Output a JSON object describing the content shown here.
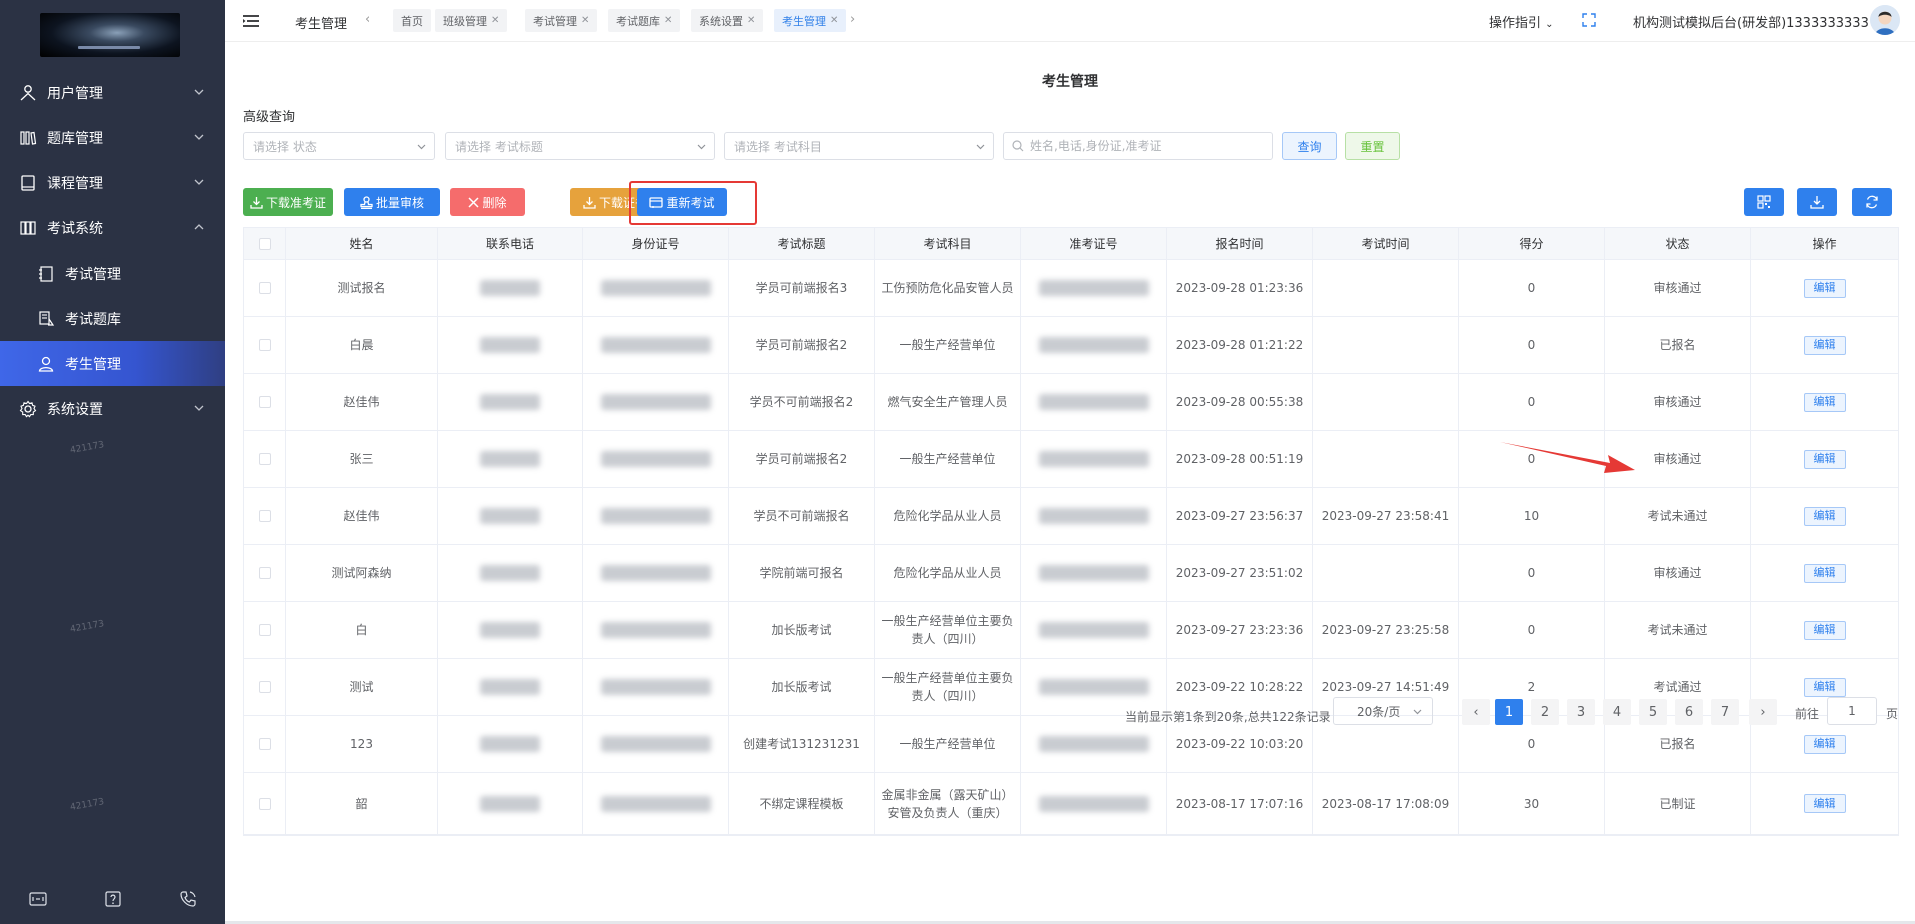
{
  "header": {
    "title": "考生管理",
    "tabs": [
      {
        "label": "首页",
        "closable": false
      },
      {
        "label": "班级管理",
        "closable": true
      },
      {
        "label": "考试管理",
        "closable": true
      },
      {
        "label": "考试题库",
        "closable": true
      },
      {
        "label": "系统设置",
        "closable": true
      },
      {
        "label": "考生管理",
        "closable": true,
        "active": true
      }
    ],
    "guide_label": "操作指引",
    "user_label": "机构测试模拟后台(研发部)1333333333"
  },
  "sidebar": {
    "menus": [
      {
        "label": "用户管理",
        "icon": "user-group-icon",
        "expanded": false
      },
      {
        "label": "题库管理",
        "icon": "books-icon",
        "expanded": false
      },
      {
        "label": "课程管理",
        "icon": "book-icon",
        "expanded": false
      },
      {
        "label": "考试系统",
        "icon": "exam-system-icon",
        "expanded": true,
        "children": [
          {
            "label": "考试管理",
            "icon": "exam-manage-icon"
          },
          {
            "label": "考试题库",
            "icon": "exam-bank-icon"
          },
          {
            "label": "考生管理",
            "icon": "person-icon",
            "active": true
          }
        ]
      },
      {
        "label": "系统设置",
        "icon": "gear-icon",
        "expanded": false
      }
    ],
    "watermark": "421173"
  },
  "main": {
    "title": "考生管理",
    "advanced_label": "高级查询",
    "filters": {
      "status_placeholder": "请选择 状态",
      "exam_title_placeholder": "请选择 考试标题",
      "subject_placeholder": "请选择 考试科目",
      "search_placeholder": "姓名,电话,身份证,准考证",
      "query_label": "查询",
      "reset_label": "重置"
    },
    "toolbar": {
      "download_ticket": "下载准考证",
      "batch_review": "批量审核",
      "delete": "删除",
      "download_cert": "下载证书",
      "reexam": "重新考试"
    },
    "columns": [
      "姓名",
      "联系电话",
      "身份证号",
      "考试标题",
      "考试科目",
      "准考证号",
      "报名时间",
      "考试时间",
      "得分",
      "状态",
      "操作"
    ],
    "rows": [
      {
        "name": "测试报名",
        "title": "学员可前端报名3",
        "subject": "工伤预防危化品安管人员",
        "reg_time": "2023-09-28 01:23:36",
        "exam_time": "",
        "score": "0",
        "status": "审核通过",
        "action": "编辑"
      },
      {
        "name": "白晨",
        "title": "学员可前端报名2",
        "subject": "一般生产经营单位",
        "reg_time": "2023-09-28 01:21:22",
        "exam_time": "",
        "score": "0",
        "status": "已报名",
        "action": "编辑"
      },
      {
        "name": "赵佳伟",
        "title": "学员不可前端报名2",
        "subject": "燃气安全生产管理人员",
        "reg_time": "2023-09-28 00:55:38",
        "exam_time": "",
        "score": "0",
        "status": "审核通过",
        "action": "编辑"
      },
      {
        "name": "张三",
        "title": "学员可前端报名2",
        "subject": "一般生产经营单位",
        "reg_time": "2023-09-28 00:51:19",
        "exam_time": "",
        "score": "0",
        "status": "审核通过",
        "action": "编辑"
      },
      {
        "name": "赵佳伟",
        "title": "学员不可前端报名",
        "subject": "危险化学品从业人员",
        "reg_time": "2023-09-27 23:56:37",
        "exam_time": "2023-09-27 23:58:41",
        "score": "10",
        "status": "考试未通过",
        "action": "编辑"
      },
      {
        "name": "测试阿森纳",
        "title": "学院前端可报名",
        "subject": "危险化学品从业人员",
        "reg_time": "2023-09-27 23:51:02",
        "exam_time": "",
        "score": "0",
        "status": "审核通过",
        "action": "编辑"
      },
      {
        "name": "白",
        "title": "加长版考试",
        "subject": "一般生产经营单位主要负责人（四川）",
        "reg_time": "2023-09-27 23:23:36",
        "exam_time": "2023-09-27 23:25:58",
        "score": "0",
        "status": "考试未通过",
        "action": "编辑"
      },
      {
        "name": "测试",
        "title": "加长版考试",
        "subject": "一般生产经营单位主要负责人（四川）",
        "reg_time": "2023-09-22 10:28:22",
        "exam_time": "2023-09-27 14:51:49",
        "score": "2",
        "status": "考试通过",
        "action": "编辑"
      },
      {
        "name": "123",
        "title": "创建考试131231231",
        "subject": "一般生产经营单位",
        "reg_time": "2023-09-22 10:03:20",
        "exam_time": "",
        "score": "0",
        "status": "已报名",
        "action": "编辑"
      },
      {
        "name": "韶",
        "title": "不绑定课程模板",
        "subject": "金属非金属（露天矿山）安管及负责人（重庆）",
        "reg_time": "2023-08-17 17:07:16",
        "exam_time": "2023-08-17 17:08:09",
        "score": "30",
        "status": "已制证",
        "action": "编辑"
      }
    ],
    "pagination": {
      "info": "当前显示第1条到20条,总共122条记录",
      "page_size": "20条/页",
      "pages": [
        "1",
        "2",
        "3",
        "4",
        "5",
        "6",
        "7"
      ],
      "current": "1",
      "goto_prefix": "前往",
      "goto_value": "1",
      "goto_suffix": "页"
    }
  },
  "colors": {
    "sidebar_bg": "#2b3244",
    "active_menu": "#3f67e8",
    "primary": "#2f80ed",
    "green": "#4caf50",
    "red": "#f56c6c",
    "orange": "#e6a23c",
    "highlight": "#e53935"
  }
}
